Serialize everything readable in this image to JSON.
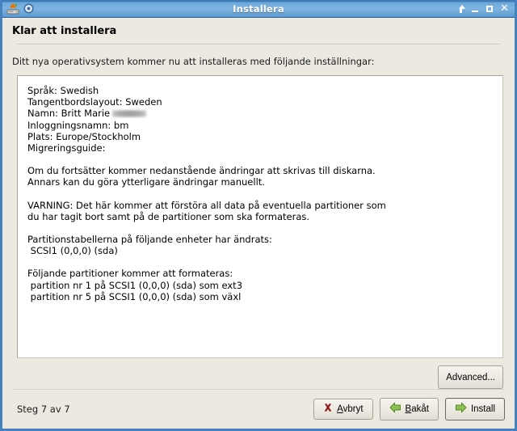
{
  "window": {
    "title": "Installera",
    "icons": {
      "app": "installer-disk-icon",
      "secondary": "circle-icon"
    },
    "controls": {
      "always_on_top": "always-on-top-icon",
      "minimize": "minimize-icon",
      "maximize": "maximize-icon",
      "close": "✕"
    }
  },
  "page": {
    "heading": "Klar att installera",
    "intro": "Ditt nya operativsystem kommer nu att installeras med följande inställningar:"
  },
  "summary": {
    "lines": [
      "Språk: Swedish",
      "Tangentbordslayout: Sweden"
    ],
    "name_label": "Namn: Britt Marie",
    "lines_after": [
      "Inloggningsnamn: bm",
      "Plats: Europe/Stockholm",
      "Migreringsguide:"
    ],
    "paragraph_continue": [
      "Om du fortsätter kommer nedanstående ändringar att skrivas till diskarna.",
      "Annars kan du göra ytterligare ändringar manuellt."
    ],
    "paragraph_warning": [
      "VARNING: Det här kommer att förstöra all data på eventuella partitioner som",
      "du har tagit bort samt på de partitioner som ska formateras."
    ],
    "paragraph_tables": [
      "Partitionstabellerna på följande enheter har ändrats:",
      " SCSI1 (0,0,0) (sda)"
    ],
    "paragraph_format": [
      "Följande partitioner kommer att formateras:",
      " partition nr 1 på SCSI1 (0,0,0) (sda) som ext3",
      " partition nr 5 på SCSI1 (0,0,0) (sda) som växl"
    ]
  },
  "buttons": {
    "advanced": "Advanced...",
    "cancel": {
      "mnemonic": "A",
      "rest": "vbryt",
      "icon": "cancel-x-icon"
    },
    "back": {
      "mnemonic": "B",
      "rest": "akåt",
      "icon": "arrow-left-icon"
    },
    "install": {
      "label": "Install",
      "icon": "arrow-right-icon"
    }
  },
  "footer": {
    "step": "Steg 7 av 7"
  },
  "colors": {
    "titlebar": "#5d9bd0",
    "window_border": "#4682bd",
    "background": "#ece9e1",
    "green_arrow": "#7cb342",
    "cancel_red": "#8f1d1d"
  }
}
